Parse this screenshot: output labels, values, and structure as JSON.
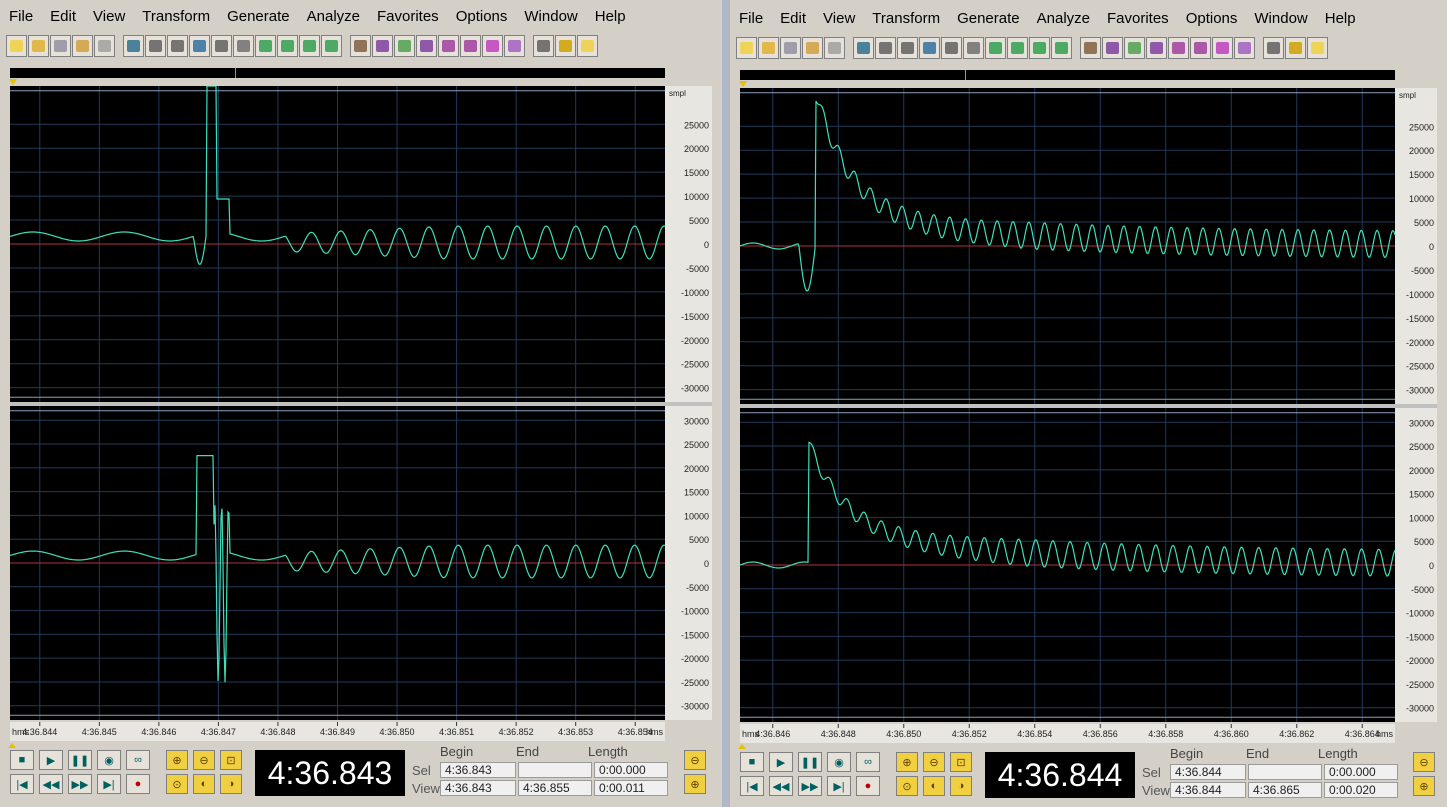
{
  "menu": [
    "File",
    "Edit",
    "View",
    "Transform",
    "Generate",
    "Analyze",
    "Favorites",
    "Options",
    "Window",
    "Help"
  ],
  "toolbar_icons": [
    "new-file-icon",
    "open-folder-icon",
    "save-icon",
    "save-as-icon",
    "close-file-icon",
    "|",
    "undo-icon",
    "redo-icon",
    "cut-icon",
    "copy-icon",
    "paste-icon",
    "mix-paste-icon",
    "trim-icon",
    "selection-icon",
    "waveform-icon",
    "loop-icon",
    "|",
    "spectral-view-icon",
    "checkbox-icon",
    "grid-icon-1",
    "grid-icon-2",
    "grid-icon-3",
    "zoom-icon",
    "properties-icon",
    "cd-icon",
    "|",
    "favorites-icon",
    "script-icon",
    "help-icon"
  ],
  "colors": {
    "wave": "#3ee0b8",
    "background": "#000000",
    "grid": "#233a5a",
    "zero_line": "#b03040",
    "limit_line": "#8aa0c0",
    "toolbar": "#d4d0c8"
  },
  "unit_label": "smpl",
  "ruler_unit": "hms",
  "left": {
    "amp_ticks": [
      "25000",
      "20000",
      "15000",
      "10000",
      "5000",
      "0",
      "-5000",
      "-10000",
      "-15000",
      "-20000",
      "-25000",
      "-30000"
    ],
    "amp_ticks2": [
      "30000",
      "25000",
      "20000",
      "15000",
      "10000",
      "5000",
      "0",
      "-5000",
      "-10000",
      "-15000",
      "-20000",
      "-25000",
      "-30000"
    ],
    "time_ticks": [
      "4:36.844",
      "4:36.845",
      "4:36.846",
      "4:36.847",
      "4:36.848",
      "4:36.849",
      "4:36.850",
      "4:36.851",
      "4:36.852",
      "4:36.853",
      "4:36.854"
    ],
    "clock": "4:36.843",
    "headers": {
      "begin": "Begin",
      "end": "End",
      "length": "Length"
    },
    "sel_label": "Sel",
    "view_label": "View",
    "sel": {
      "begin": "4:36.843",
      "end": "",
      "length": "0:00.000"
    },
    "view": {
      "begin": "4:36.843",
      "end": "4:36.855",
      "length": "0:00.011"
    }
  },
  "right": {
    "amp_ticks": [
      "25000",
      "20000",
      "15000",
      "10000",
      "5000",
      "0",
      "-5000",
      "-10000",
      "-15000",
      "-20000",
      "-25000",
      "-30000"
    ],
    "amp_ticks2": [
      "30000",
      "25000",
      "20000",
      "15000",
      "10000",
      "5000",
      "0",
      "-5000",
      "-10000",
      "-15000",
      "-20000",
      "-25000",
      "-30000"
    ],
    "time_ticks": [
      "4:36.846",
      "4:36.848",
      "4:36.850",
      "4:36.852",
      "4:36.854",
      "4:36.856",
      "4:36.858",
      "4:36.860",
      "4:36.862",
      "4:36.864"
    ],
    "clock": "4:36.844",
    "headers": {
      "begin": "Begin",
      "end": "End",
      "length": "Length"
    },
    "sel_label": "Sel",
    "view_label": "View",
    "sel": {
      "begin": "4:36.844",
      "end": "",
      "length": "0:00.000"
    },
    "view": {
      "begin": "4:36.844",
      "end": "4:36.865",
      "length": "0:00.020"
    }
  },
  "transport_icons": [
    "stop-icon",
    "play-icon",
    "pause-icon",
    "play-to-end-icon",
    "loop-play-icon",
    "go-start-icon",
    "rewind-icon",
    "fast-forward-icon",
    "go-end-icon",
    "record-icon"
  ],
  "zoom_icons": [
    "zoom-in-icon",
    "zoom-out-icon",
    "zoom-full-icon",
    "zoom-selection-icon",
    "zoom-left-icon",
    "zoom-right-icon"
  ]
}
